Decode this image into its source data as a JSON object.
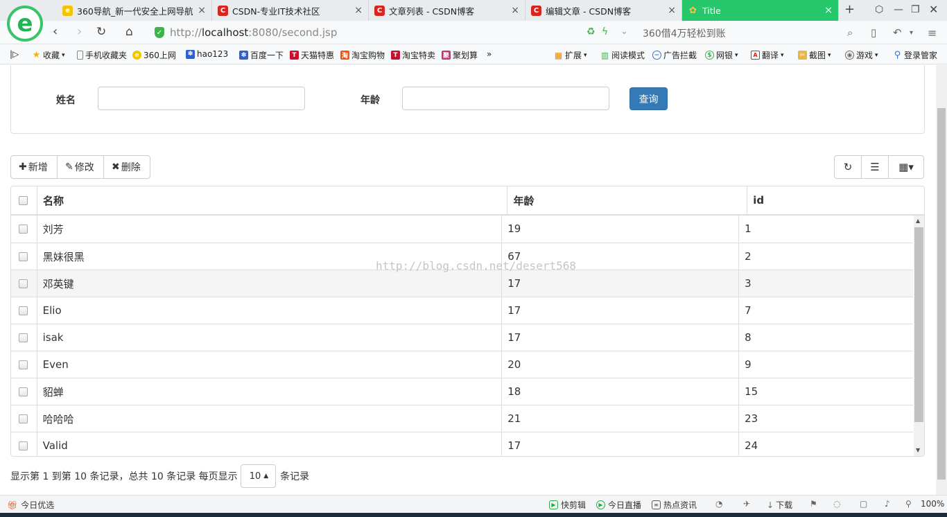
{
  "browser": {
    "tabs": [
      {
        "title": "360导航_新一代安全上网导航",
        "icon_color": "#f5c400",
        "icon_glyph": "e",
        "active": false
      },
      {
        "title": "CSDN-专业IT技术社区",
        "icon_color": "#d9251c",
        "icon_glyph": "C",
        "active": false
      },
      {
        "title": "文章列表 - CSDN博客",
        "icon_color": "#d9251c",
        "icon_glyph": "C",
        "active": false
      },
      {
        "title": "编辑文章 - CSDN博客",
        "icon_color": "#d9251c",
        "icon_glyph": "C",
        "active": false
      },
      {
        "title": "Title",
        "icon_color": "#f2c94c",
        "icon_glyph": "✿",
        "active": true
      }
    ],
    "new_tab_glyph": "+",
    "url_host": "http://",
    "url_domain": "localhost",
    "url_rest": ":8080/second.jsp",
    "ad_text": "360借4万轻松到账",
    "logo_glyph": "e",
    "bookmarks": [
      "收藏",
      "手机收藏夹",
      "360上网",
      "hao123",
      "百度一下",
      "天猫特惠",
      "淘宝购物",
      "淘宝特卖",
      "聚划算"
    ],
    "bookmark_more": "»",
    "extensions": [
      "扩展",
      "阅读模式",
      "广告拦截",
      "网银",
      "翻译",
      "截图",
      "游戏",
      "登录管家"
    ]
  },
  "search": {
    "name_label": "姓名",
    "age_label": "年龄",
    "name_value": "",
    "age_value": "",
    "query_button": "查询"
  },
  "toolbar": {
    "add_label": "新增",
    "edit_label": "修改",
    "delete_label": "删除",
    "refresh_icon": "↻",
    "list_icon": "☰",
    "columns_icon": "▦▾"
  },
  "table": {
    "headers": [
      "名称",
      "年龄",
      "id"
    ],
    "rows": [
      {
        "name": "刘芳",
        "age": "19",
        "id": "1"
      },
      {
        "name": "黑妹很黑",
        "age": "67",
        "id": "2"
      },
      {
        "name": "邓英键",
        "age": "17",
        "id": "3"
      },
      {
        "name": "Elio",
        "age": "17",
        "id": "7"
      },
      {
        "name": "isak",
        "age": "17",
        "id": "8"
      },
      {
        "name": "Even",
        "age": "20",
        "id": "9"
      },
      {
        "name": "貂蝉",
        "age": "18",
        "id": "15"
      },
      {
        "name": "哈哈哈",
        "age": "21",
        "id": "23"
      },
      {
        "name": "Valid",
        "age": "17",
        "id": "24"
      }
    ]
  },
  "watermark": "http://blog.csdn.net/desert568",
  "pagination": {
    "summary": "显示第 1 到第 10 条记录，总共 10 条记录 每页显示",
    "page_size": "10",
    "suffix": "条记录"
  },
  "statusbar": {
    "left": "今日优选",
    "items": [
      "快剪辑",
      "今日直播",
      "热点资讯",
      "下载"
    ],
    "zoom": "100%"
  },
  "colors": {
    "primary": "#337ab7",
    "active_tab": "#27c76b"
  }
}
